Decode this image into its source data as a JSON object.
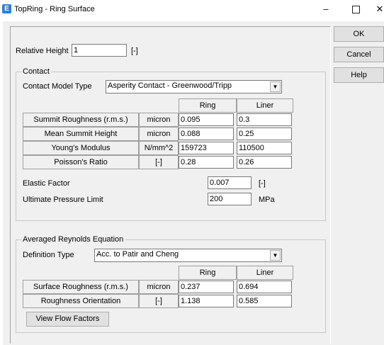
{
  "window": {
    "title": "TopRing - Ring Surface",
    "app_icon_glyph": "E",
    "controls": {
      "minimize": "–",
      "close": "✕"
    }
  },
  "buttons": {
    "ok": "OK",
    "cancel": "Cancel",
    "help": "Help"
  },
  "relative_height": {
    "label": "Relative Height",
    "value": "1",
    "unit": "[-]"
  },
  "contact": {
    "group_title": "Contact",
    "model_type_label": "Contact Model Type",
    "model_type_value": "Asperity Contact - Greenwood/Tripp",
    "columns": {
      "ring": "Ring",
      "liner": "Liner"
    },
    "rows": [
      {
        "label": "Summit Roughness (r.m.s.)",
        "unit": "micron",
        "ring": "0.095",
        "liner": "0.3"
      },
      {
        "label": "Mean Summit Height",
        "unit": "micron",
        "ring": "0.088",
        "liner": "0.25"
      },
      {
        "label": "Young's Modulus",
        "unit": "N/mm^2",
        "ring": "159723",
        "liner": "110500"
      },
      {
        "label": "Poisson's Ratio",
        "unit": "[-]",
        "ring": "0.28",
        "liner": "0.26"
      }
    ],
    "elastic_factor": {
      "label": "Elastic Factor",
      "value": "0.007",
      "unit": "[-]"
    },
    "ultimate_pressure": {
      "label": "Ultimate Pressure Limit",
      "value": "200",
      "unit": "MPa"
    }
  },
  "reynolds": {
    "group_title": "Averaged Reynolds Equation",
    "definition_type_label": "Definition Type",
    "definition_type_value": "Acc. to Patir and Cheng",
    "columns": {
      "ring": "Ring",
      "liner": "Liner"
    },
    "rows": [
      {
        "label": "Surface Roughness (r.m.s.)",
        "unit": "micron",
        "ring": "0.237",
        "liner": "0.694"
      },
      {
        "label": "Roughness Orientation",
        "unit": "[-]",
        "ring": "1.138",
        "liner": "0.585"
      }
    ],
    "view_flow_factors": "View Flow Factors"
  }
}
